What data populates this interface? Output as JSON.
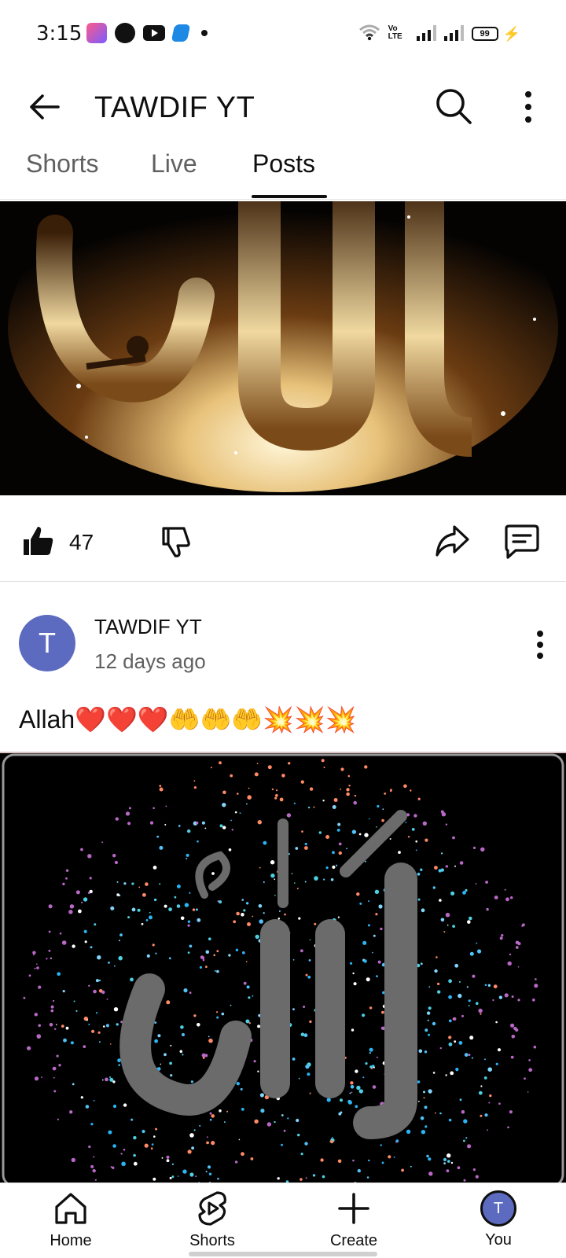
{
  "status_bar": {
    "time": "3:15",
    "battery": "99",
    "network": "Vo LTE",
    "notification_icons": [
      "app-icon",
      "app-icon",
      "youtube-icon",
      "app-icon",
      "dot-icon"
    ]
  },
  "header": {
    "title": "TAWDIF YT",
    "icons": [
      "back-arrow-icon",
      "search-icon",
      "more-vertical-icon"
    ]
  },
  "tabs": [
    {
      "label": "Shorts",
      "active": false
    },
    {
      "label": "Live",
      "active": false
    },
    {
      "label": "Posts",
      "active": true
    }
  ],
  "post_1_actions": {
    "like_count": "47",
    "icons": [
      "thumbs-up-icon",
      "thumbs-down-icon",
      "share-icon",
      "comment-icon"
    ]
  },
  "post_2": {
    "avatar_letter": "T",
    "author": "TAWDIF YT",
    "time_ago": "12 days ago",
    "text": "Allah❤️❤️❤️🤲🤲🤲💥💥💥"
  },
  "bottom_nav": [
    {
      "label": "Home",
      "icon": "home-icon"
    },
    {
      "label": "Shorts",
      "icon": "shorts-icon"
    },
    {
      "label": "Create",
      "icon": "plus-icon"
    },
    {
      "label": "You",
      "icon": "avatar",
      "avatar_letter": "T"
    }
  ],
  "colors": {
    "avatar": "#5c6bc0",
    "text_primary": "#0f0f0f",
    "text_secondary": "#606060"
  }
}
